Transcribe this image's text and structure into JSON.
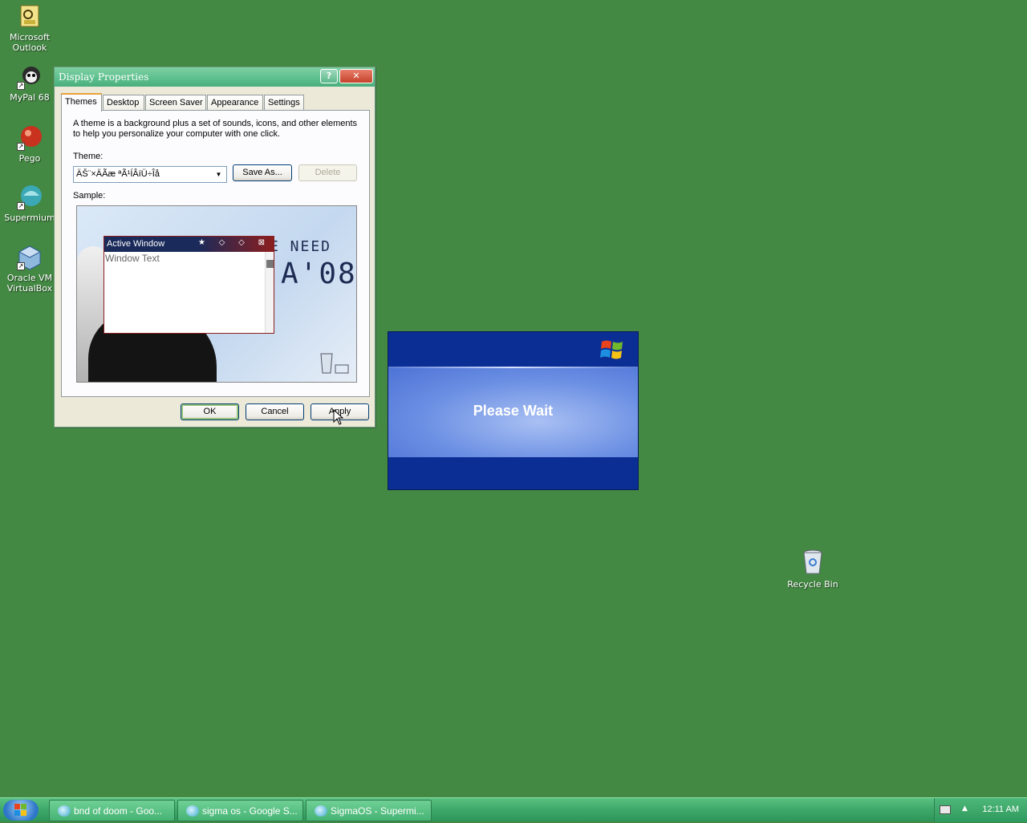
{
  "desktop": {
    "icons": [
      {
        "label": "Microsoft Outlook",
        "icon": "outlook-icon"
      },
      {
        "label": "MyPal 68",
        "icon": "mypal-icon"
      },
      {
        "label": "Pego",
        "icon": "pego-icon"
      },
      {
        "label": "Supermium",
        "icon": "supermium-icon"
      },
      {
        "label": "Oracle VM VirtualBox",
        "icon": "virtualbox-icon"
      }
    ],
    "recycle_bin": "Recycle Bin"
  },
  "window": {
    "title": "Display Properties",
    "help_glyph": "?",
    "close_glyph": "✕",
    "tabs": [
      "Themes",
      "Desktop",
      "Screen Saver",
      "Appearance",
      "Settings"
    ],
    "active_tab": "Themes",
    "description": "A theme is a background plus a set of sounds, icons, and other elements to help you personalize your computer with one click.",
    "theme_label": "Theme:",
    "theme_value": "ÄŠ¨×ÄÃæ ªÃ¹ÍÂíÜ÷Îå",
    "save_as": "Save As...",
    "delete": "Delete",
    "sample_label": "Sample:",
    "sample": {
      "poster_line1": "E NEED",
      "poster_line2": "A'08",
      "mini_title": "Active Window",
      "mini_glyphs": "★ ◇ ◇ ⊠",
      "mini_text": "Window Text"
    },
    "ok": "OK",
    "cancel": "Cancel",
    "apply": "Apply"
  },
  "please_wait": {
    "text": "Please Wait"
  },
  "taskbar": {
    "tasks": [
      "bnd of doom - Goo...",
      "sigma os - Google S...",
      "SigmaOS - Supermi..."
    ],
    "clock": "12:11 AM"
  }
}
